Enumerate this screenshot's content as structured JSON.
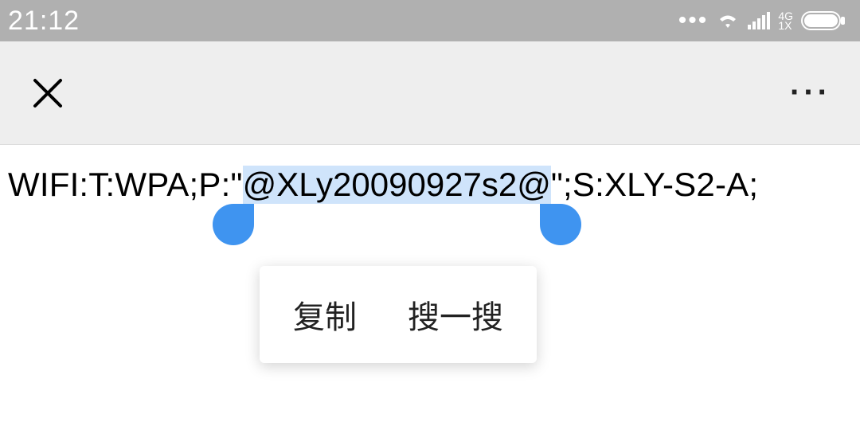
{
  "status": {
    "time": "21:12",
    "dots": "•••",
    "net_top": "4G",
    "net_bottom": "1X"
  },
  "content": {
    "prefix": "WIFI:T:WPA;P:\"",
    "selected": "@XLy20090927s2@",
    "suffix": "\";S:XLY-S2-A;"
  },
  "menu": {
    "copy": "复制",
    "search": "搜一搜"
  }
}
